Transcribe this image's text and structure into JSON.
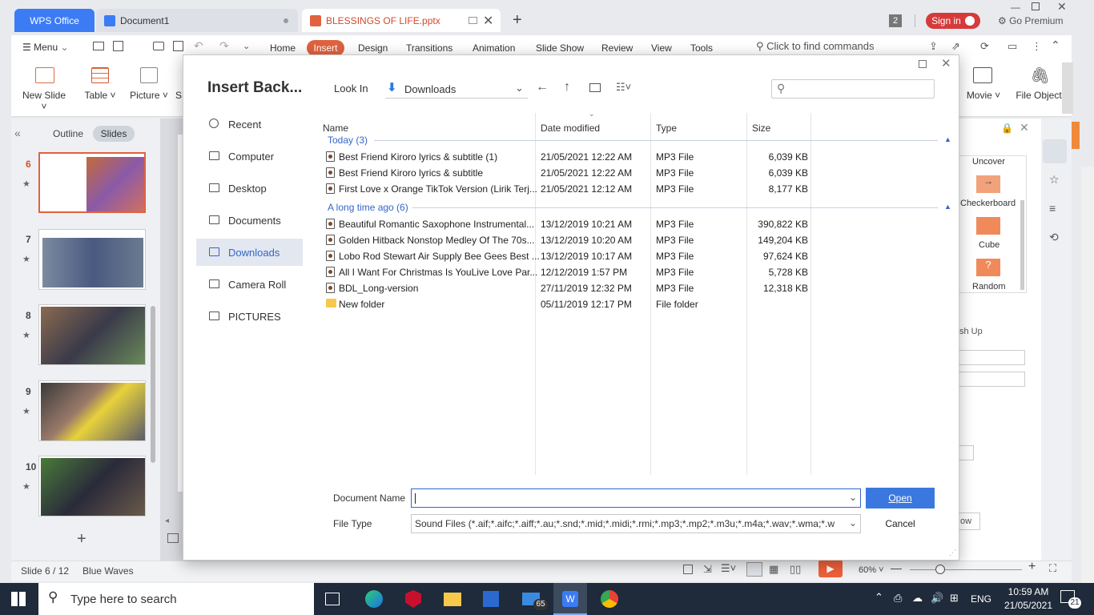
{
  "titlebar": {
    "wps_tab": "WPS Office",
    "doc_tab": "Document1",
    "ppt_tab": "BLESSINGS OF LIFE.pptx",
    "window_count": "2",
    "sign_in": "Sign in",
    "premium": "Go Premium"
  },
  "menu": {
    "menu_label": "Menu",
    "tabs": [
      "Home",
      "Insert",
      "Design",
      "Transitions",
      "Animation",
      "Slide Show",
      "Review",
      "View",
      "Tools"
    ],
    "search": "Click to find commands"
  },
  "ribbon": {
    "new_slide": "New Slide",
    "table": "Table",
    "picture": "Picture",
    "movie": "Movie",
    "file_object": "File Object"
  },
  "left_panel": {
    "outline": "Outline",
    "slides": "Slides",
    "slide_numbers": [
      "6",
      "7",
      "8",
      "9",
      "10"
    ]
  },
  "right_panel": {
    "items": [
      "Uncover",
      "Checkerboard",
      "Cube",
      "Random"
    ],
    "partial_label": "sh Up",
    "partial_button": "ow"
  },
  "statusbar": {
    "slide": "Slide 6 / 12",
    "theme": "Blue Waves",
    "zoom": "60%"
  },
  "dialog": {
    "title": "Insert Back...",
    "look_in_label": "Look In",
    "look_in_value": "Downloads",
    "nav": [
      "Recent",
      "Computer",
      "Desktop",
      "Documents",
      "Downloads",
      "Camera Roll",
      "PICTURES"
    ],
    "columns": [
      "Name",
      "Date modified",
      "Type",
      "Size"
    ],
    "groups": [
      {
        "label": "Today (3)",
        "files": [
          {
            "name": "Best Friend Kiroro lyrics & subtitle (1)",
            "date": "21/05/2021 12:22 AM",
            "type": "MP3 File",
            "size": "6,039 KB"
          },
          {
            "name": "Best Friend Kiroro lyrics & subtitle",
            "date": "21/05/2021 12:22 AM",
            "type": "MP3 File",
            "size": "6,039 KB"
          },
          {
            "name": "First Love x Orange TikTok Version (Lirik Terj...",
            "date": "21/05/2021 12:12 AM",
            "type": "MP3 File",
            "size": "8,177 KB"
          }
        ]
      },
      {
        "label": "A long time ago (6)",
        "files": [
          {
            "name": "Beautiful Romantic Saxophone Instrumental...",
            "date": "13/12/2019 10:21 AM",
            "type": "MP3 File",
            "size": "390,822 KB"
          },
          {
            "name": "Golden Hitback Nonstop Medley Of The 70s...",
            "date": "13/12/2019 10:20 AM",
            "type": "MP3 File",
            "size": "149,204 KB"
          },
          {
            "name": "Lobo Rod Stewart Air Supply Bee Gees  Best ...",
            "date": "13/12/2019 10:17 AM",
            "type": "MP3 File",
            "size": "97,624 KB"
          },
          {
            "name": "All I Want For Christmas Is YouLive Love Par...",
            "date": "12/12/2019 1:57 PM",
            "type": "MP3 File",
            "size": "5,728 KB"
          },
          {
            "name": "BDL_Long-version",
            "date": "27/11/2019 12:32 PM",
            "type": "MP3 File",
            "size": "12,318 KB"
          },
          {
            "name": "New folder",
            "date": "05/11/2019 12:17 PM",
            "type": "File folder",
            "size": ""
          }
        ]
      }
    ],
    "doc_name_label": "Document Name",
    "doc_name_value": "",
    "file_type_label": "File Type",
    "file_type_value": "Sound Files (*.aif;*.aifc;*.aiff;*.au;*.snd;*.mid;*.midi;*.rmi;*.mp3;*.mp2;*.m3u;*.m4a;*.wav;*.wma;*.w",
    "open": "Open",
    "cancel": "Cancel"
  },
  "taskbar": {
    "search": "Type here to search",
    "mail_badge": "65",
    "lang": "ENG",
    "time": "10:59 AM",
    "date": "21/05/2021",
    "notifications": "21"
  }
}
